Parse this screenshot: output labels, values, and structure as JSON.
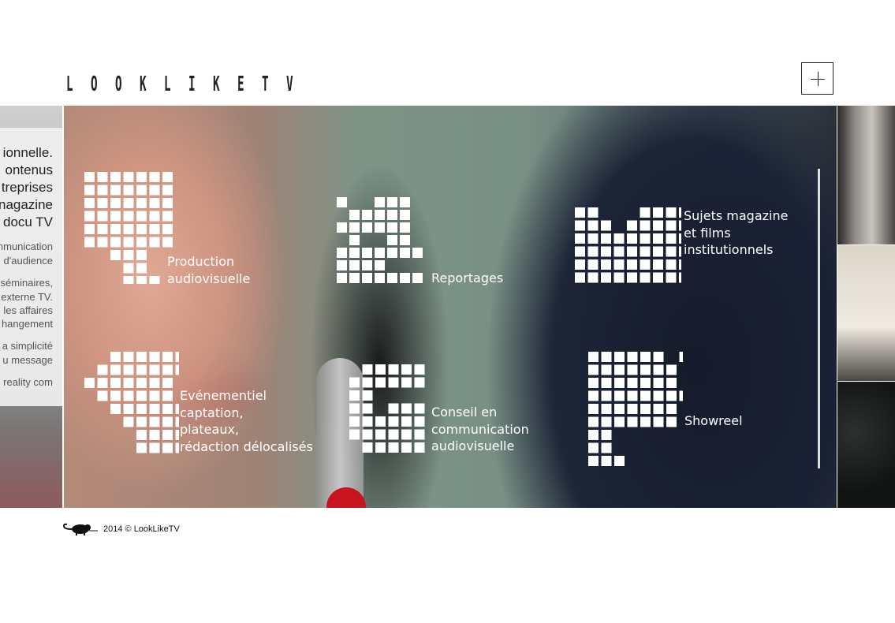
{
  "header": {
    "logo_letters": [
      "L",
      "O",
      "O",
      "K",
      "L",
      "I",
      "K",
      "E",
      "T",
      "V"
    ],
    "menu_button_icon": "plus-icon"
  },
  "slide_left": {
    "text_lines": [
      "ionnelle.",
      "ontenus",
      "treprises",
      "nagazine",
      "docu TV",
      "mmunication",
      "d'audience",
      "séminaires,",
      "externe TV.",
      "les affaires",
      "hangement",
      "a simplicité",
      "u message",
      "reality com"
    ]
  },
  "services": [
    {
      "id": "production",
      "label_lines": [
        "Production",
        "audiovisuelle"
      ],
      "icon": "pixel-1-icon"
    },
    {
      "id": "reportages",
      "label_lines": [
        "Reportages"
      ],
      "icon": "pixel-2-icon"
    },
    {
      "id": "sujets",
      "label_lines": [
        "Sujets magazine",
        "et films",
        "institutionnels"
      ],
      "icon": "pixel-m-icon"
    },
    {
      "id": "evenementiel",
      "label_lines": [
        "Evénementiel",
        "captation,",
        "plateaux,",
        "rédaction délocalisés"
      ],
      "icon": "pixel-4-icon"
    },
    {
      "id": "conseil",
      "label_lines": [
        "Conseil en",
        "communication",
        "audiovisuelle"
      ],
      "icon": "pixel-5-icon"
    },
    {
      "id": "showreel",
      "label_lines": [
        "Showreel"
      ],
      "icon": "pixel-p-icon"
    }
  ],
  "footer": {
    "copyright": "2014 © LookLikeTV",
    "logo_icon": "chameleon-icon"
  },
  "colors": {
    "text_dark": "#222222",
    "overlay_white": "#ffffff",
    "nail_red": "#c8141e"
  }
}
